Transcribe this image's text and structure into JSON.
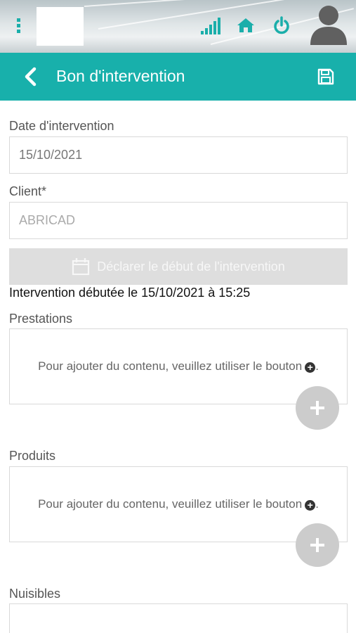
{
  "status_bar": {
    "icons": [
      "menu-icon",
      "signal-icon",
      "home-icon",
      "power-icon",
      "avatar-icon"
    ],
    "accent_color": "#1aaeaa"
  },
  "header": {
    "title": "Bon d'intervention",
    "background": "#18b0ab",
    "back_icon": "chevron-left-icon",
    "save_icon": "floppy-disk-icon"
  },
  "form": {
    "date": {
      "label": "Date d'intervention",
      "value": "15/10/2021"
    },
    "client": {
      "label": "Client*",
      "value": "ABRICAD"
    },
    "start_button": {
      "label": "Déclarer le début de l'intervention",
      "icon": "calendar-icon"
    },
    "started_text": "Intervention débutée le 15/10/2021 à 15:25",
    "sections": [
      {
        "label": "Prestations",
        "hint": "Pour ajouter du contenu, veuillez utiliser le bouton",
        "hint_end": "."
      },
      {
        "label": "Produits",
        "hint": "Pour ajouter du contenu, veuillez utiliser le bouton",
        "hint_end": "."
      },
      {
        "label": "Nuisibles"
      }
    ]
  }
}
